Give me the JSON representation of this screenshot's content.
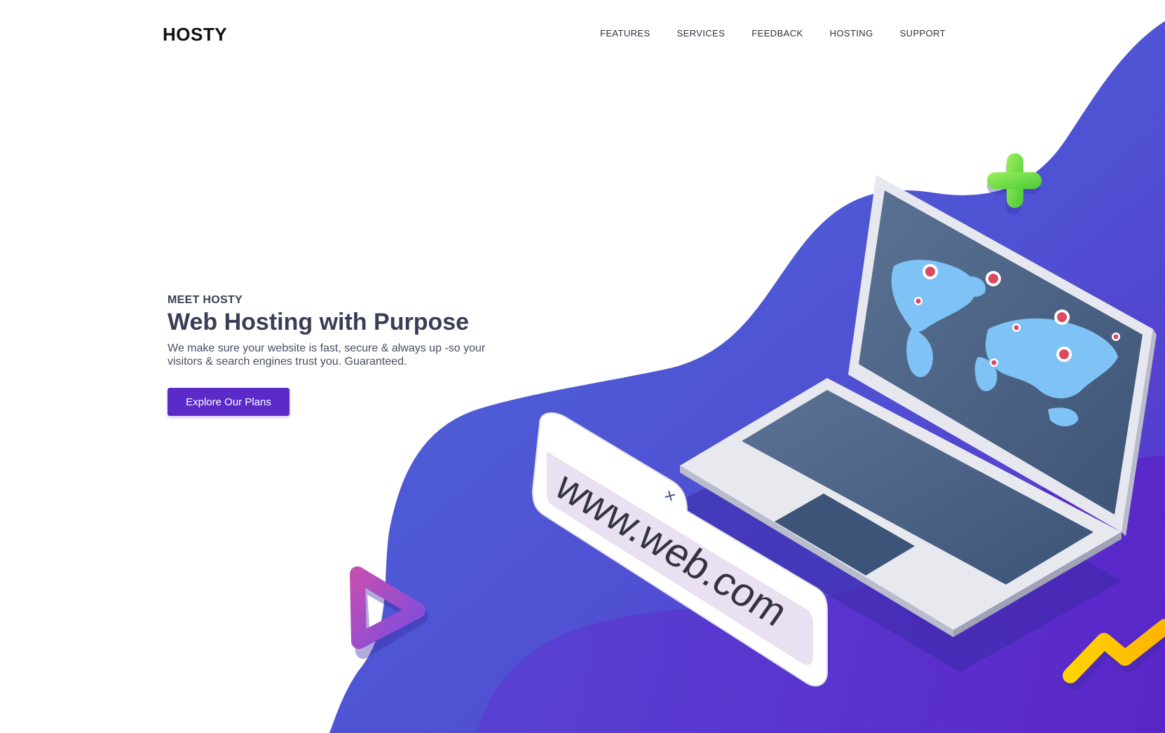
{
  "brand": {
    "logo_text": "HOSTY"
  },
  "nav": {
    "items": [
      {
        "label": "FEATURES"
      },
      {
        "label": "SERVICES"
      },
      {
        "label": "FEEDBACK"
      },
      {
        "label": "HOSTING"
      },
      {
        "label": "SUPPORT"
      }
    ]
  },
  "hero": {
    "eyebrow": "MEET HOSTY",
    "headline": "Web Hosting with Purpose",
    "subtext": "We make sure your website is fast, secure & always up -so your visitors & search engines trust you. Guaranteed.",
    "cta_label": "Explore Our Plans"
  },
  "illustration": {
    "url_text": "www.web.com"
  },
  "colors": {
    "accent": "#5b2bc9",
    "blob_light": "#4e6bd8",
    "blob_dark": "#5a24c8",
    "plus_green": "#7be04a",
    "triangle_purple": "#9b4fd0",
    "zigzag_yellow": "#ffc800",
    "map_blue": "#7fc2f5",
    "screen_slate": "#4a6283"
  },
  "icons": {
    "plus": "plus-icon",
    "triangle": "triangle-icon",
    "zigzag": "zigzag-icon",
    "pin": "map-pin-icon"
  }
}
